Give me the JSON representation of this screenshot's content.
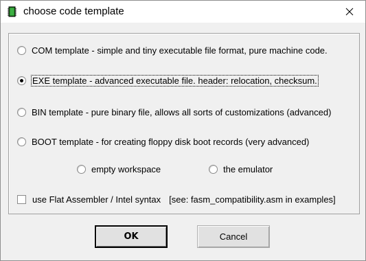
{
  "window": {
    "title": "choose code template",
    "icon": "chip-icon",
    "close_icon": "close-icon"
  },
  "options": {
    "com": {
      "label": "COM template - simple and tiny executable file format, pure machine code.",
      "checked": false
    },
    "exe": {
      "label": "EXE template - advanced executable file. header: relocation, checksum.",
      "checked": true
    },
    "bin": {
      "label": "BIN template - pure binary file, allows all sorts of customizations (advanced)",
      "checked": false
    },
    "boot": {
      "label": "BOOT template - for creating floppy disk boot records (very advanced)",
      "checked": false
    },
    "empty": {
      "label": "empty workspace",
      "checked": false
    },
    "emulator": {
      "label": "the emulator",
      "checked": false
    }
  },
  "flat_asm": {
    "label": "use Flat Assembler / Intel syntax",
    "hint": "[see: fasm_compatibility.asm in examples]",
    "checked": false
  },
  "buttons": {
    "ok": "OK",
    "cancel": "Cancel"
  },
  "colors": {
    "dialog_bg": "#f0f0f0",
    "titlebar_bg": "#ffffff",
    "chip_icon": "#2f8f2f"
  }
}
